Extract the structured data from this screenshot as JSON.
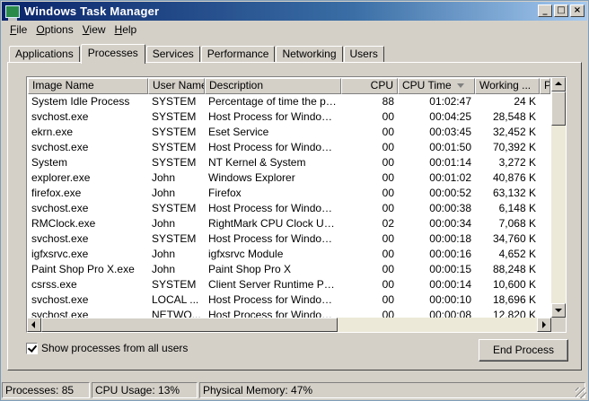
{
  "window": {
    "title": "Windows Task Manager"
  },
  "menu": [
    {
      "label": "File",
      "ul": "F",
      "rest": "ile"
    },
    {
      "label": "Options",
      "ul": "O",
      "rest": "ptions"
    },
    {
      "label": "View",
      "ul": "V",
      "rest": "iew"
    },
    {
      "label": "Help",
      "ul": "H",
      "rest": "elp"
    }
  ],
  "tabs": [
    "Applications",
    "Processes",
    "Services",
    "Performance",
    "Networking",
    "Users"
  ],
  "active_tab": "Processes",
  "columns": [
    "Image Name",
    "User Name",
    "Description",
    "CPU",
    "CPU Time",
    "Working ...",
    "P"
  ],
  "sorted_column": "CPU Time",
  "rows": [
    [
      "System Idle Process",
      "SYSTEM",
      "Percentage of time the pro...",
      "88",
      "01:02:47",
      "24 K"
    ],
    [
      "svchost.exe",
      "SYSTEM",
      "Host Process for Windows ...",
      "00",
      "00:04:25",
      "28,548 K"
    ],
    [
      "ekrn.exe",
      "SYSTEM",
      "Eset Service",
      "00",
      "00:03:45",
      "32,452 K"
    ],
    [
      "svchost.exe",
      "SYSTEM",
      "Host Process for Windows ...",
      "00",
      "00:01:50",
      "70,392 K"
    ],
    [
      "System",
      "SYSTEM",
      "NT Kernel & System",
      "00",
      "00:01:14",
      "3,272 K"
    ],
    [
      "explorer.exe",
      "John",
      "Windows Explorer",
      "00",
      "00:01:02",
      "40,876 K"
    ],
    [
      "firefox.exe",
      "John",
      "Firefox",
      "00",
      "00:00:52",
      "63,132 K"
    ],
    [
      "svchost.exe",
      "SYSTEM",
      "Host Process for Windows ...",
      "00",
      "00:00:38",
      "6,148 K"
    ],
    [
      "RMClock.exe",
      "John",
      "RightMark CPU Clock Utility",
      "02",
      "00:00:34",
      "7,068 K"
    ],
    [
      "svchost.exe",
      "SYSTEM",
      "Host Process for Windows ...",
      "00",
      "00:00:18",
      "34,760 K"
    ],
    [
      "igfxsrvc.exe",
      "John",
      "igfxsrvc Module",
      "00",
      "00:00:16",
      "4,652 K"
    ],
    [
      "Paint Shop Pro X.exe",
      "John",
      "Paint Shop Pro X",
      "00",
      "00:00:15",
      "88,248 K"
    ],
    [
      "csrss.exe",
      "SYSTEM",
      "Client Server Runtime Proc...",
      "00",
      "00:00:14",
      "10,600 K"
    ],
    [
      "svchost.exe",
      "LOCAL ...",
      "Host Process for Windows ...",
      "00",
      "00:00:10",
      "18,696 K"
    ],
    [
      "svchost.exe",
      "NETWO...",
      "Host Process for Windows ...",
      "00",
      "00:00:08",
      "12,820 K"
    ]
  ],
  "checkbox": {
    "label": "Show processes from all users",
    "checked": true
  },
  "end_process_button": "End Process",
  "status": {
    "processes": "Processes: 85",
    "cpu_usage": "CPU Usage: 13%",
    "physical_memory": "Physical Memory: 47%"
  },
  "colors": {
    "title_gradient_start": "#0a246a",
    "title_gradient_end": "#a6caf0",
    "face": "#d4d0c8"
  },
  "icons": {
    "app": "task-manager-icon",
    "min": "minimize-icon",
    "max": "maximize-icon",
    "close": "close-icon"
  }
}
